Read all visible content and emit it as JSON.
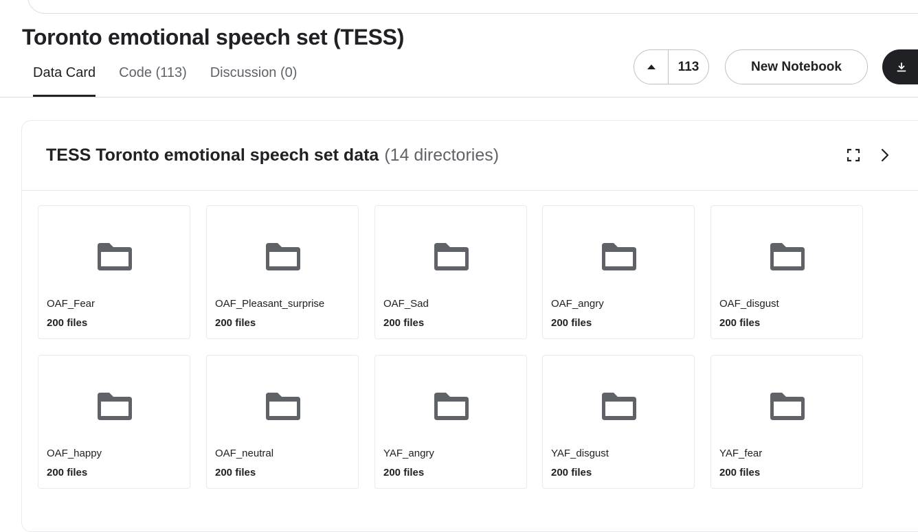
{
  "dataset": {
    "title": "Toronto emotional speech set (TESS)"
  },
  "tabs": [
    {
      "label": "Data Card"
    },
    {
      "label": "Code (113)"
    },
    {
      "label": "Discussion (0)"
    }
  ],
  "actions": {
    "vote_count": "113",
    "new_notebook_label": "New Notebook"
  },
  "data_explorer": {
    "title": "TESS Toronto emotional speech set data",
    "count": "(14 directories)",
    "folders": [
      {
        "name": "OAF_Fear",
        "files": "200 files"
      },
      {
        "name": "OAF_Pleasant_surprise",
        "files": "200 files"
      },
      {
        "name": "OAF_Sad",
        "files": "200 files"
      },
      {
        "name": "OAF_angry",
        "files": "200 files"
      },
      {
        "name": "OAF_disgust",
        "files": "200 files"
      },
      {
        "name": "OAF_happy",
        "files": "200 files"
      },
      {
        "name": "OAF_neutral",
        "files": "200 files"
      },
      {
        "name": "YAF_angry",
        "files": "200 files"
      },
      {
        "name": "YAF_disgust",
        "files": "200 files"
      },
      {
        "name": "YAF_fear",
        "files": "200 files"
      }
    ]
  },
  "icons": {
    "upvote": "upvote-arrow-icon",
    "download": "download-icon",
    "expand": "fullscreen-icon",
    "chevron": "chevron-right-icon",
    "folder": "folder-icon"
  }
}
